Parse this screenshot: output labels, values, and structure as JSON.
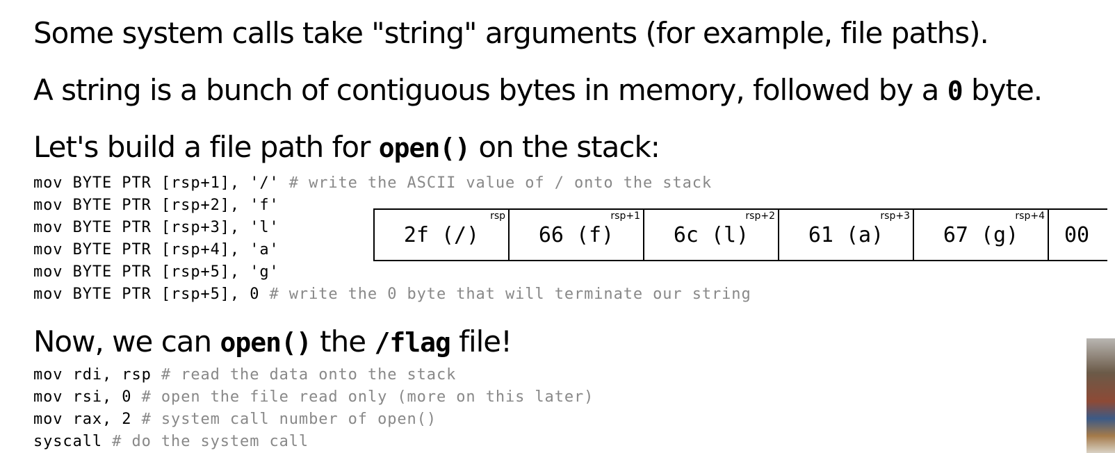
{
  "headings": {
    "h1": "Some system calls take \"string\" arguments (for example, file paths).",
    "h2_pre": "A string is a bunch of contiguous bytes in memory, followed by a ",
    "h2_code": "0",
    "h2_post": " byte.",
    "h3_pre": "Let's build a file path for ",
    "h3_code": "open()",
    "h3_post": " on the stack:",
    "h4_pre": "Now, we can ",
    "h4_code1": "open()",
    "h4_mid": " the ",
    "h4_code2": "/flag",
    "h4_post": " file!"
  },
  "build_code": [
    {
      "code": "mov BYTE PTR [rsp+1], '/' ",
      "comment": "# write the ASCII value of / onto the stack"
    },
    {
      "code": "mov BYTE PTR [rsp+2], 'f'",
      "comment": ""
    },
    {
      "code": "mov BYTE PTR [rsp+3], 'l'",
      "comment": ""
    },
    {
      "code": "mov BYTE PTR [rsp+4], 'a'",
      "comment": ""
    },
    {
      "code": "mov BYTE PTR [rsp+5], 'g'",
      "comment": ""
    },
    {
      "code": "mov BYTE PTR [rsp+5], 0 ",
      "comment": "# write the 0 byte that will terminate our string"
    }
  ],
  "stack_cells": [
    {
      "value": "2f (/)",
      "offset": "rsp"
    },
    {
      "value": "66 (f)",
      "offset": "rsp+1"
    },
    {
      "value": "6c (l)",
      "offset": "rsp+2"
    },
    {
      "value": "61 (a)",
      "offset": "rsp+3"
    },
    {
      "value": "67 (g)",
      "offset": "rsp+4"
    },
    {
      "value": "00",
      "offset": ""
    }
  ],
  "open_code": [
    {
      "code": "mov rdi, rsp ",
      "comment": "# read the data onto the stack"
    },
    {
      "code": "mov rsi, 0 ",
      "comment": "# open the file read only (more on this later)"
    },
    {
      "code": "mov rax, 2 ",
      "comment": "# system call number of open()"
    },
    {
      "code": "syscall ",
      "comment": "# do the system call"
    }
  ]
}
